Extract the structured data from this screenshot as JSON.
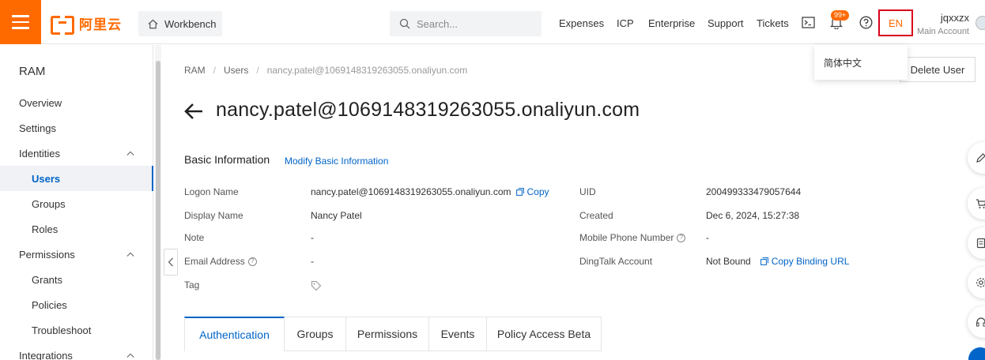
{
  "header": {
    "logo_text": "阿里云",
    "workbench_label": "Workbench",
    "search_placeholder": "Search...",
    "nav": [
      "Expenses",
      "ICP",
      "Enterprise",
      "Support",
      "Tickets"
    ],
    "notification_badge": "99+",
    "language": "EN",
    "user_name": "jqxxzx",
    "user_sub": "Main Account",
    "accent_color": "#ff6a00"
  },
  "language_menu": {
    "option": "简体中文"
  },
  "sidebar": {
    "title": "RAM",
    "items": [
      {
        "label": "Overview",
        "level": 1
      },
      {
        "label": "Settings",
        "level": 1
      },
      {
        "label": "Identities",
        "level": 1,
        "expandable": true
      },
      {
        "label": "Users",
        "level": 2,
        "active": true
      },
      {
        "label": "Groups",
        "level": 2
      },
      {
        "label": "Roles",
        "level": 2
      },
      {
        "label": "Permissions",
        "level": 1,
        "expandable": true
      },
      {
        "label": "Grants",
        "level": 2
      },
      {
        "label": "Policies",
        "level": 2
      },
      {
        "label": "Troubleshoot",
        "level": 2
      },
      {
        "label": "Integrations",
        "level": 1,
        "expandable": true
      }
    ]
  },
  "breadcrumb": [
    "RAM",
    "Users",
    "nancy.patel@1069148319263055.onaliyun.com"
  ],
  "delete_button": "Delete User",
  "page_title": "nancy.patel@1069148319263055.onaliyun.com",
  "basic_info": {
    "title": "Basic Information",
    "modify_link": "Modify Basic Information",
    "copy_label": "Copy",
    "copy_binding_label": "Copy Binding URL",
    "left_fields": [
      {
        "label": "Logon Name",
        "value": "nancy.patel@1069148319263055.onaliyun.com"
      },
      {
        "label": "Display Name",
        "value": "Nancy Patel"
      },
      {
        "label": "Note",
        "value": "-"
      },
      {
        "label": "Email Address",
        "value": "-"
      },
      {
        "label": "Tag",
        "value": ""
      }
    ],
    "right_fields": [
      {
        "label": "UID",
        "value": "200499333479057644"
      },
      {
        "label": "Created",
        "value": "Dec 6, 2024, 15:27:38"
      },
      {
        "label": "Mobile Phone Number",
        "value": "-"
      },
      {
        "label": "DingTalk Account",
        "value": "Not Bound"
      }
    ]
  },
  "tabs": [
    {
      "label": "Authentication",
      "active": true
    },
    {
      "label": "Groups"
    },
    {
      "label": "Permissions"
    },
    {
      "label": "Events"
    },
    {
      "label": "Policy Access Beta"
    }
  ]
}
